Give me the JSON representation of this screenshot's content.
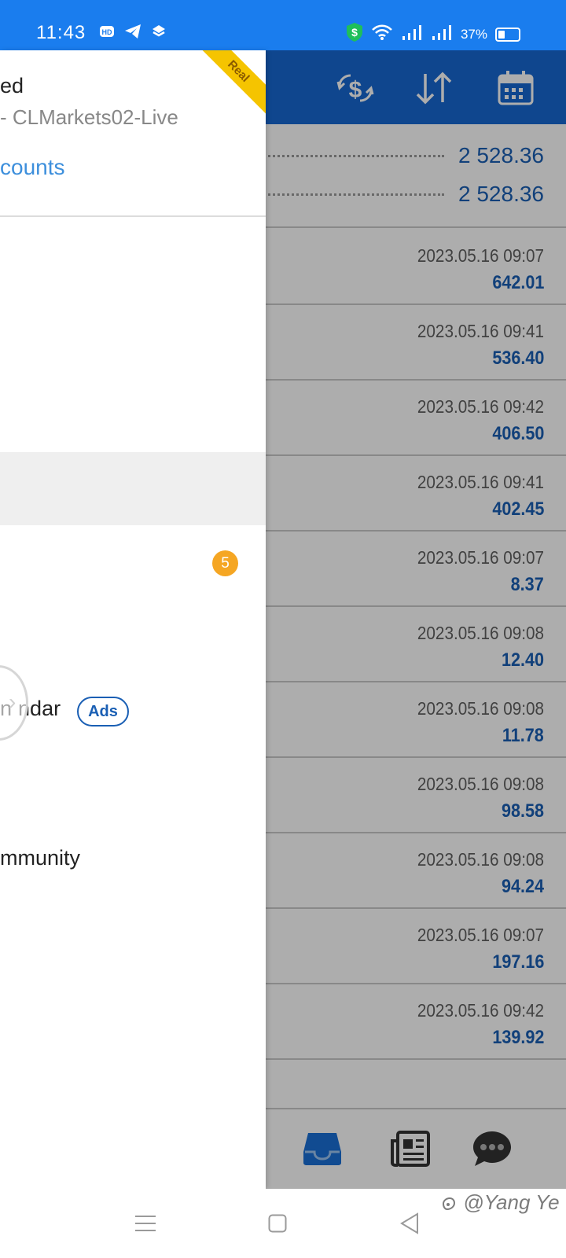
{
  "status_bar": {
    "time": "11:43",
    "battery_percent": "37%",
    "left_icons": [
      "hd-icon",
      "telegram-icon",
      "layers-icon"
    ],
    "right_icons": [
      "shield-dollar-icon",
      "wifi-icon",
      "signal-icon",
      "signal-icon"
    ]
  },
  "header": {
    "icons": [
      "currency-exchange-icon",
      "sort-icon",
      "calendar-icon"
    ],
    "color": "#1768d2"
  },
  "balances": [
    "2 528.36",
    "2 528.36"
  ],
  "trades": [
    {
      "date": "2023.05.16 09:07",
      "amount": "642.01"
    },
    {
      "date": "2023.05.16 09:41",
      "amount": "536.40"
    },
    {
      "date": "2023.05.16 09:42",
      "amount": "406.50"
    },
    {
      "date": "2023.05.16 09:41",
      "amount": "402.45"
    },
    {
      "date": "2023.05.16 09:07",
      "amount": "8.37"
    },
    {
      "date": "2023.05.16 09:08",
      "amount": "12.40"
    },
    {
      "date": "2023.05.16 09:08",
      "amount": "11.78"
    },
    {
      "date": "2023.05.16 09:08",
      "amount": "98.58"
    },
    {
      "date": "2023.05.16 09:08",
      "amount": "94.24"
    },
    {
      "date": "2023.05.16 09:07",
      "amount": "197.16"
    },
    {
      "date": "2023.05.16 09:42",
      "amount": "139.92"
    }
  ],
  "bottom_tabs": [
    "inbox-icon",
    "news-icon",
    "chat-icon"
  ],
  "drawer": {
    "account_name": "ed",
    "account_server": "- CLMarkets02-Live",
    "accounts_link": "counts",
    "ribbon": "Real",
    "badge_count": "5",
    "menu_calendar": "ndar",
    "menu_calendar_prefix": "n",
    "ads_label": "Ads",
    "menu_community": "munity",
    "menu_community_prefix": "m"
  },
  "navbar": {
    "watermark": "@Yang Ye"
  }
}
